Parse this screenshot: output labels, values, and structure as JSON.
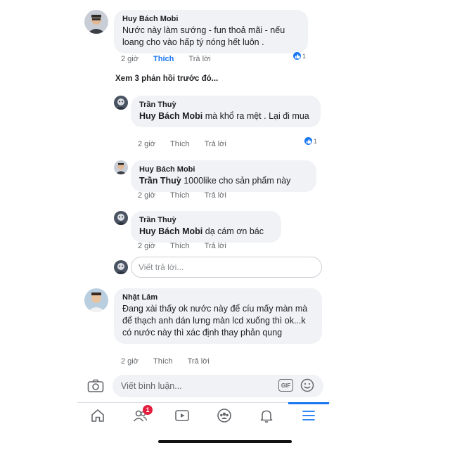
{
  "comments": [
    {
      "author": "Huy Bách Mobi",
      "text": "Nước này làm sướng - fun thoả mãi - nếu loang cho vào hấp tý nóng hết luôn .",
      "time": "2 giờ",
      "like": "Thích",
      "reply": "Trả lời",
      "reactions": "1"
    },
    {
      "author": "Nhật Lâm",
      "text": "Đang xài thấy ok nước này để cíu mấy màn mà để thạch anh dán lưng màn lcd xuống thì ok...k có nước này thì xác định thay phản qung",
      "time": "2 giờ",
      "like": "Thích",
      "reply": "Trả lời"
    }
  ],
  "see_previous": "Xem 3 phản hồi trước đó...",
  "replies": [
    {
      "author": "Trần Thuỳ",
      "mention": "Huy Bách Mobi",
      "text": " mà khổ ra  mệt  . Lại đi mua",
      "time": "2 giờ",
      "like": "Thích",
      "reply": "Trả lời",
      "reactions": "1"
    },
    {
      "author": "Huy Bách Mobi",
      "mention": "Trần Thuỳ",
      "text": " 1000like cho sản phẩm này",
      "time": "2 giờ",
      "like": "Thích",
      "reply": "Trả lời"
    },
    {
      "author": "Trần Thuỳ",
      "mention": "Huy Bách Mobi",
      "text": " dạ cám ơn bác",
      "time": "2 giờ",
      "like": "Thích",
      "reply": "Trả lời"
    }
  ],
  "reply_input": {
    "placeholder": "Viết trả lời..."
  },
  "composer": {
    "placeholder": "Viết bình luận...",
    "gif_label": "GIF"
  },
  "tabbar": {
    "items": [
      "home-icon",
      "friends-icon",
      "watch-icon",
      "groups-icon",
      "notifications-icon",
      "menu-icon"
    ],
    "friends_badge": "1",
    "active": "menu-icon"
  },
  "colors": {
    "accent": "#1877f2",
    "bubble": "#f0f2f5",
    "secondary_text": "#65676b",
    "badge": "#e41e3f"
  }
}
